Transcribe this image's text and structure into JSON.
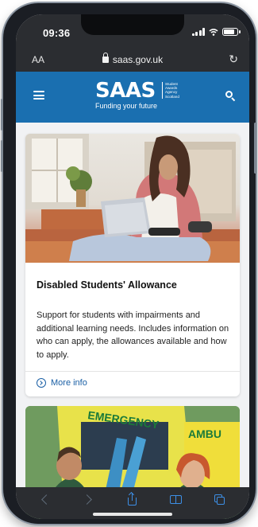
{
  "status_bar": {
    "time": "09:36"
  },
  "browser": {
    "text_size_label": "AA",
    "url": "saas.gov.uk"
  },
  "site_header": {
    "logo_word": "SAAS",
    "logo_sub_lines": [
      "Student",
      "Awards",
      "Agency",
      "Scotland"
    ],
    "logo_tagline": "Funding your future"
  },
  "cards": [
    {
      "title": "Disabled Students' Allowance",
      "description": "Support for students with impairments and additional learning needs. Includes information on who can apply, the allowances available and how to apply.",
      "link_label": "More info"
    },
    {
      "image_labels": [
        "EMERGENCY",
        "AMBU"
      ]
    }
  ],
  "icons": {
    "menu": "hamburger-icon",
    "search": "search-icon",
    "lock": "lock-icon",
    "reload": "reload-icon",
    "back": "back-arrow-icon",
    "forward": "forward-arrow-icon",
    "share": "share-icon",
    "bookmarks": "book-icon",
    "tabs": "tabs-icon"
  },
  "colors": {
    "header": "#1a6fb0",
    "link": "#1a5fa5",
    "toolbar": "#2b2d31",
    "toolbar_active": "#3d8fe6"
  }
}
